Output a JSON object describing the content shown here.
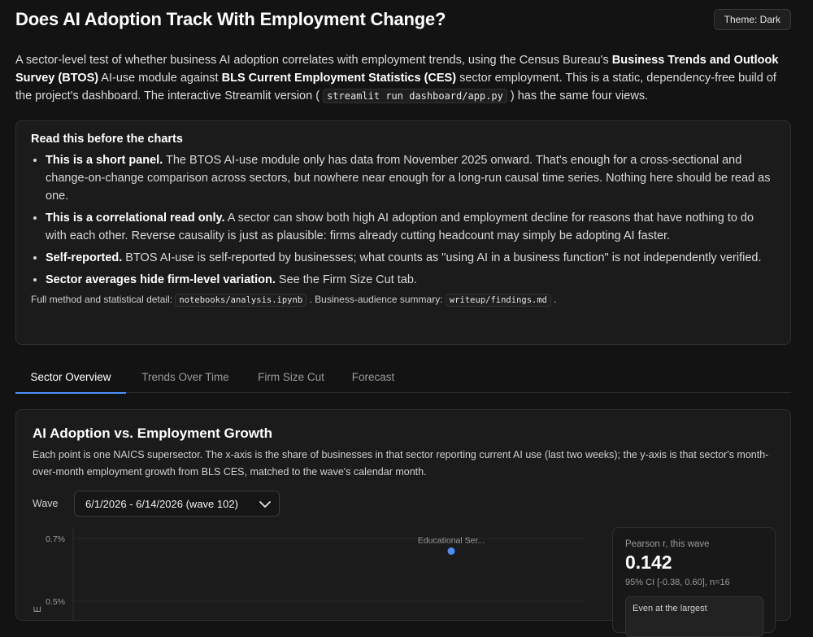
{
  "header": {
    "title": "Does AI Adoption Track With Employment Change?",
    "theme_button": "Theme: Dark"
  },
  "intro": {
    "p1": "A sector-level test of whether business AI adoption correlates with employment trends, using the Census Bureau's ",
    "b1": "Business Trends and Outlook Survey (BTOS)",
    "p2": " AI-use module against ",
    "b2": "BLS Current Employment Statistics (CES)",
    "p3": " sector employment. This is a static, dependency-free build of the project's dashboard. The interactive Streamlit version ( ",
    "code": "streamlit run dashboard/app.py",
    "p4": " ) has the same four views."
  },
  "callout": {
    "title": "Read this before the charts",
    "items": [
      {
        "bold": "This is a short panel.",
        "text": " The BTOS AI-use module only has data from November 2025 onward. That's enough for a cross-sectional and change-on-change comparison across sectors, but nowhere near enough for a long-run causal time series. Nothing here should be read as one."
      },
      {
        "bold": "This is a correlational read only.",
        "text": " A sector can show both high AI adoption and employment decline for reasons that have nothing to do with each other. Reverse causality is just as plausible: firms already cutting headcount may simply be adopting AI faster."
      },
      {
        "bold": "Self-reported.",
        "text": " BTOS AI-use is self-reported by businesses; what counts as \"using AI in a business function\" is not independently verified."
      },
      {
        "bold": "Sector averages hide firm-level variation.",
        "text": " See the Firm Size Cut tab."
      }
    ],
    "method_prefix": "Full method and statistical detail: ",
    "method_code1": "notebooks/analysis.ipynb",
    "method_mid": " . Business-audience summary: ",
    "method_code2": "writeup/findings.md",
    "method_suffix": " ."
  },
  "tabs": [
    {
      "label": "Sector Overview",
      "active": true
    },
    {
      "label": "Trends Over Time",
      "active": false
    },
    {
      "label": "Firm Size Cut",
      "active": false
    },
    {
      "label": "Forecast",
      "active": false
    }
  ],
  "card": {
    "title": "AI Adoption vs. Employment Growth",
    "description": "Each point is one NAICS supersector. The x-axis is the share of businesses in that sector reporting current AI use (last two weeks); the y-axis is that sector's month-over-month employment growth from BLS CES, matched to the wave's calendar month.",
    "wave_label": "Wave",
    "wave_value": "6/1/2026 - 6/14/2026 (wave 102)"
  },
  "chart_data": {
    "type": "scatter",
    "y_ticks": [
      "0.7%",
      "0.5%"
    ],
    "y_tick_values": [
      0.7,
      0.5
    ],
    "ylabel": "E",
    "points": [
      {
        "label": "Educational Ser...",
        "y": 0.66
      }
    ],
    "point_color": "#4c8ef7"
  },
  "stats": {
    "label": "Pearson r, this wave",
    "value": "0.142",
    "ci": "95% CI [-0.38, 0.60], n=16",
    "note": "Even at the largest"
  }
}
